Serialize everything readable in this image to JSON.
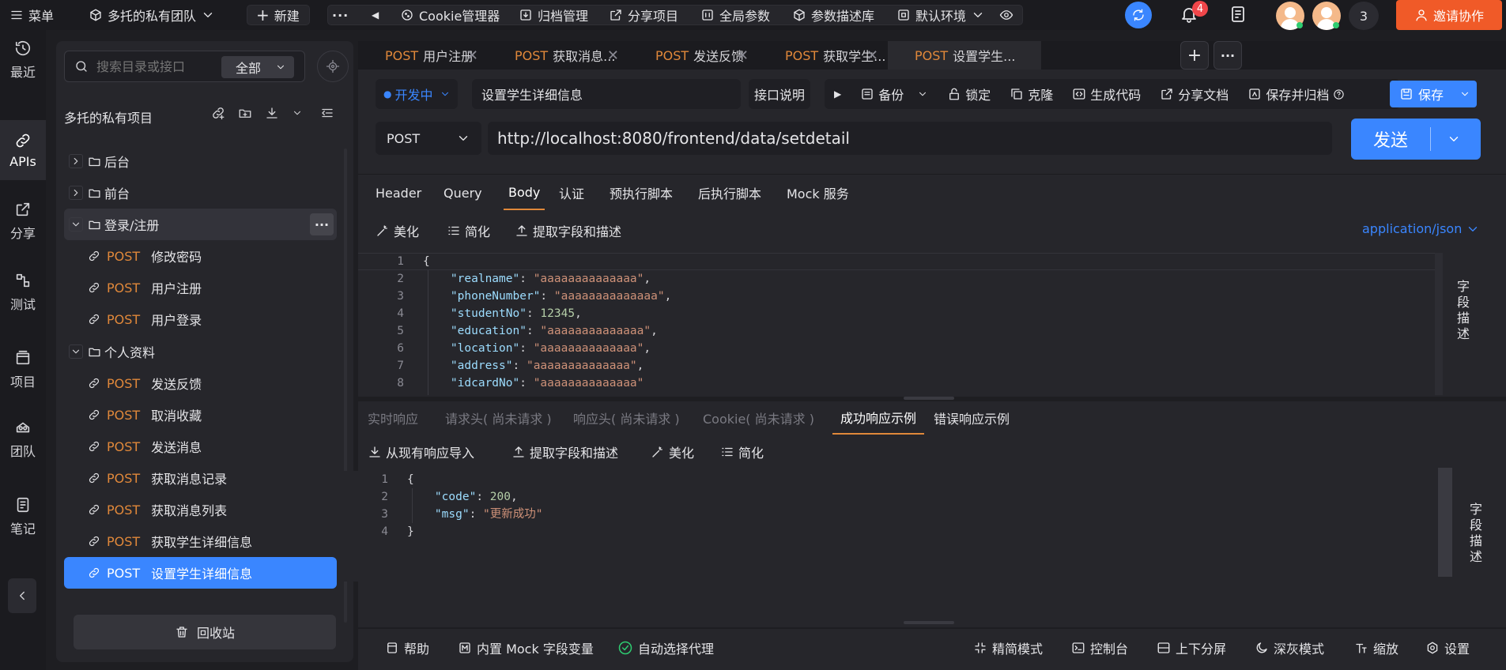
{
  "topbar": {
    "menu": "菜单",
    "team": "多托的私有团队",
    "new": "新建",
    "more": "···",
    "cookie": "Cookie管理器",
    "archive": "归档管理",
    "share_project": "分享项目",
    "global_params": "全局参数",
    "param_lib": "参数描述库",
    "env": "默认环境",
    "notify_count": "4",
    "member_count": "3",
    "invite": "邀请协作"
  },
  "rail": [
    {
      "label": "最近",
      "icon": "clock-icon"
    },
    {
      "label": "APIs",
      "icon": "link-icon"
    },
    {
      "label": "分享",
      "icon": "share-icon"
    },
    {
      "label": "测试",
      "icon": "test-icon"
    },
    {
      "label": "项目",
      "icon": "project-icon"
    },
    {
      "label": "团队",
      "icon": "team-icon"
    },
    {
      "label": "笔记",
      "icon": "note-icon"
    }
  ],
  "sidepanel": {
    "search_placeholder": "搜索目录或接口",
    "filter": "全部",
    "project_name": "多托的私有项目",
    "tree": [
      {
        "type": "folder",
        "label": "后台",
        "expanded": false
      },
      {
        "type": "folder",
        "label": "前台",
        "expanded": false
      },
      {
        "type": "folder",
        "label": "登录/注册",
        "expanded": true
      },
      {
        "type": "api",
        "method": "POST",
        "label": "修改密码"
      },
      {
        "type": "api",
        "method": "POST",
        "label": "用户注册"
      },
      {
        "type": "api",
        "method": "POST",
        "label": "用户登录"
      },
      {
        "type": "folder",
        "label": "个人资料",
        "expanded": true
      },
      {
        "type": "api",
        "method": "POST",
        "label": "发送反馈"
      },
      {
        "type": "api",
        "method": "POST",
        "label": "取消收藏"
      },
      {
        "type": "api",
        "method": "POST",
        "label": "发送消息"
      },
      {
        "type": "api",
        "method": "POST",
        "label": "获取消息记录"
      },
      {
        "type": "api",
        "method": "POST",
        "label": "获取消息列表"
      },
      {
        "type": "api",
        "method": "POST",
        "label": "获取学生详细信息"
      },
      {
        "type": "api",
        "method": "POST",
        "label": "设置学生详细信息"
      }
    ],
    "recycle": "回收站"
  },
  "tabs": [
    {
      "method": "POST",
      "label": "用户注册"
    },
    {
      "method": "POST",
      "label": "获取消息..."
    },
    {
      "method": "POST",
      "label": "发送反馈"
    },
    {
      "method": "POST",
      "label": "获取学生..."
    },
    {
      "method": "POST",
      "label": "设置学生..."
    }
  ],
  "request": {
    "status": "开发中",
    "name": "设置学生详细信息",
    "doc": "接口说明",
    "backup": "备份",
    "lock": "锁定",
    "clone": "克隆",
    "gen_code": "生成代码",
    "share_doc": "分享文档",
    "save_archive": "保存并归档",
    "save": "保存",
    "method": "POST",
    "url": "http://localhost:8080/frontend/data/setdetail",
    "send": "发送"
  },
  "req_tabs": [
    "Header",
    "Query",
    "Body",
    "认证",
    "预执行脚本",
    "后执行脚本",
    "Mock 服务"
  ],
  "body_tools": {
    "beautify": "美化",
    "simplify": "简化",
    "extract": "提取字段和描述",
    "content_type": "application/json"
  },
  "body_lines": [
    {
      "n": "1",
      "parts": [
        [
          "p",
          "{"
        ]
      ]
    },
    {
      "n": "2",
      "parts": [
        [
          "p",
          "    "
        ],
        [
          "k",
          "\"realname\""
        ],
        [
          "p",
          ": "
        ],
        [
          "s",
          "\"aaaaaaaaaaaaaa\""
        ],
        [
          "p",
          ","
        ]
      ]
    },
    {
      "n": "3",
      "parts": [
        [
          "p",
          "    "
        ],
        [
          "k",
          "\"phoneNumber\""
        ],
        [
          "p",
          ": "
        ],
        [
          "s",
          "\"aaaaaaaaaaaaaa\""
        ],
        [
          "p",
          ","
        ]
      ]
    },
    {
      "n": "4",
      "parts": [
        [
          "p",
          "    "
        ],
        [
          "k",
          "\"studentNo\""
        ],
        [
          "p",
          ": "
        ],
        [
          "n",
          "12345"
        ],
        [
          "p",
          ","
        ]
      ]
    },
    {
      "n": "5",
      "parts": [
        [
          "p",
          "    "
        ],
        [
          "k",
          "\"education\""
        ],
        [
          "p",
          ": "
        ],
        [
          "s",
          "\"aaaaaaaaaaaaaa\""
        ],
        [
          "p",
          ","
        ]
      ]
    },
    {
      "n": "6",
      "parts": [
        [
          "p",
          "    "
        ],
        [
          "k",
          "\"location\""
        ],
        [
          "p",
          ": "
        ],
        [
          "s",
          "\"aaaaaaaaaaaaaa\""
        ],
        [
          "p",
          ","
        ]
      ]
    },
    {
      "n": "7",
      "parts": [
        [
          "p",
          "    "
        ],
        [
          "k",
          "\"address\""
        ],
        [
          "p",
          ": "
        ],
        [
          "s",
          "\"aaaaaaaaaaaaaa\""
        ],
        [
          "p",
          ","
        ]
      ]
    },
    {
      "n": "8",
      "parts": [
        [
          "p",
          "    "
        ],
        [
          "k",
          "\"idcardNo\""
        ],
        [
          "p",
          ": "
        ],
        [
          "s",
          "\"aaaaaaaaaaaaaa\""
        ]
      ]
    }
  ],
  "field_desc": "字段描述",
  "resp_tabs": [
    {
      "label": "实时响应",
      "state": "off"
    },
    {
      "label": "请求头( 尚未请求 )",
      "state": "off"
    },
    {
      "label": "响应头( 尚未请求 )",
      "state": "off"
    },
    {
      "label": "Cookie( 尚未请求 )",
      "state": "off"
    },
    {
      "label": "成功响应示例",
      "state": "active"
    },
    {
      "label": "错误响应示例",
      "state": "on"
    }
  ],
  "resp_tools": {
    "import": "从现有响应导入",
    "extract": "提取字段和描述",
    "beautify": "美化",
    "simplify": "简化"
  },
  "resp_lines": [
    {
      "n": "1",
      "parts": [
        [
          "p",
          "{"
        ]
      ]
    },
    {
      "n": "2",
      "parts": [
        [
          "p",
          "    "
        ],
        [
          "k",
          "\"code\""
        ],
        [
          "p",
          ": "
        ],
        [
          "n",
          "200"
        ],
        [
          "p",
          ","
        ]
      ]
    },
    {
      "n": "3",
      "parts": [
        [
          "p",
          "    "
        ],
        [
          "k",
          "\"msg\""
        ],
        [
          "p",
          ": "
        ],
        [
          "s",
          "\"更新成功\""
        ]
      ]
    },
    {
      "n": "4",
      "parts": [
        [
          "p",
          "}"
        ]
      ]
    }
  ],
  "footer": {
    "help": "帮助",
    "mock_vars": "内置 Mock 字段变量",
    "auto_proxy": "自动选择代理",
    "simple_mode": "精简模式",
    "console": "控制台",
    "split": "上下分屏",
    "dark_mode": "深灰模式",
    "zoom": "缩放",
    "settings": "设置"
  },
  "colors": {
    "accent": "#3a86ff",
    "post": "#e0883a",
    "invite": "#f05a28",
    "badge": "#f0464a"
  }
}
